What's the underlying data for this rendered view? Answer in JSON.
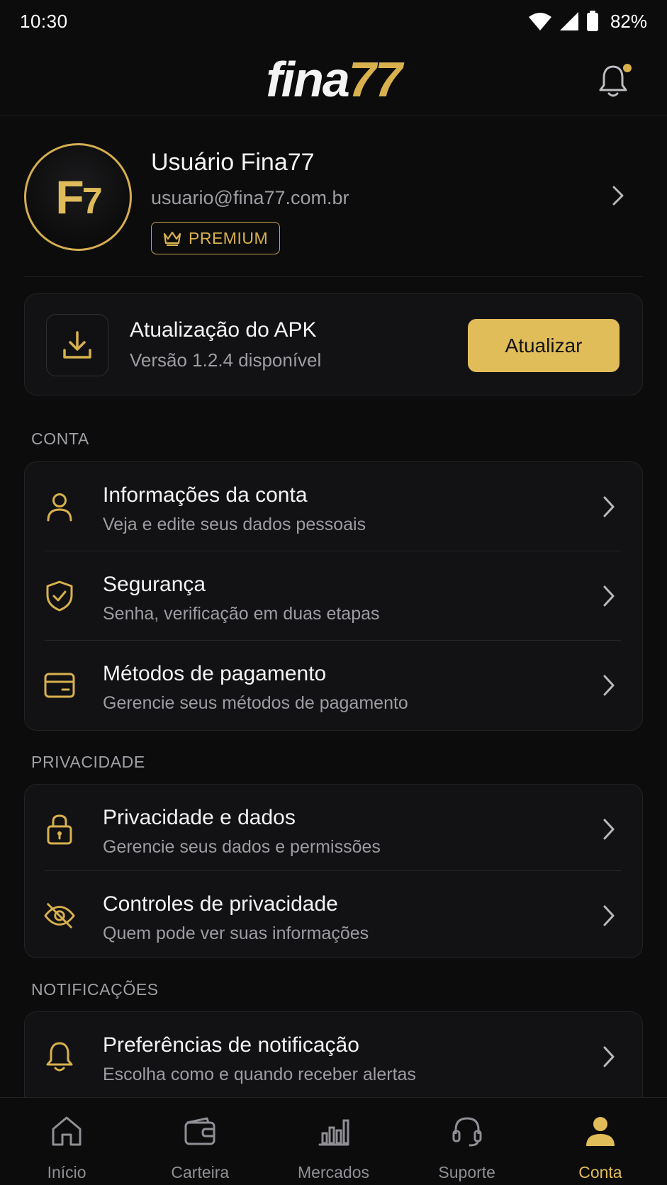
{
  "status_bar": {
    "time": "10:30",
    "battery": "82%"
  },
  "header": {
    "logo_part1": "fina",
    "logo_part2": "77"
  },
  "profile": {
    "avatar_initials_main": "F",
    "avatar_initials_sub": "7",
    "name": "Usuário Fina77",
    "email": "usuario@fina77.com.br",
    "badge": "PREMIUM"
  },
  "update": {
    "title": "Atualização do APK",
    "subtitle": "Versão 1.2.4 disponível",
    "button": "Atualizar"
  },
  "sections": {
    "conta": {
      "label": "CONTA",
      "items": [
        {
          "title": "Informações da conta",
          "subtitle": "Veja e edite seus dados pessoais",
          "icon": "user-icon"
        },
        {
          "title": "Segurança",
          "subtitle": "Senha, verificação em duas etapas",
          "icon": "shield-check-icon"
        },
        {
          "title": "Métodos de pagamento",
          "subtitle": "Gerencie seus métodos de pagamento",
          "icon": "credit-card-icon"
        }
      ]
    },
    "privacidade": {
      "label": "PRIVACIDADE",
      "items": [
        {
          "title": "Privacidade e dados",
          "subtitle": "Gerencie seus dados e permissões",
          "icon": "lock-icon"
        },
        {
          "title": "Controles de privacidade",
          "subtitle": "Quem pode ver suas informações",
          "icon": "eye-off-icon"
        }
      ]
    },
    "notificacoes": {
      "label": "NOTIFICAÇÕES",
      "items": [
        {
          "title": "Preferências de notificação",
          "subtitle": "Escolha como e quando receber alertas",
          "icon": "bell-icon"
        }
      ]
    }
  },
  "bottom_nav": [
    {
      "label": "Início",
      "icon": "home-icon",
      "active": false
    },
    {
      "label": "Carteira",
      "icon": "wallet-icon",
      "active": false
    },
    {
      "label": "Mercados",
      "icon": "bar-chart-icon",
      "active": false
    },
    {
      "label": "Suporte",
      "icon": "headset-icon",
      "active": false
    },
    {
      "label": "Conta",
      "icon": "user-filled-icon",
      "active": true
    }
  ],
  "colors": {
    "accent": "#d8b14e",
    "background": "#0c0c0d",
    "card": "#121214",
    "muted_text": "#9d9da3"
  }
}
